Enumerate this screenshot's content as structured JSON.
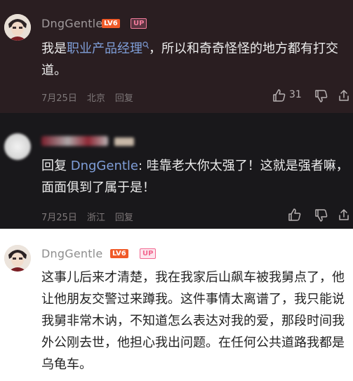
{
  "comments": [
    {
      "username": "DngGentle",
      "level_badge": "LV6",
      "up_badge": "UP",
      "text_prefix": "我是",
      "text_link": "职业产品经理",
      "text_suffix": "，所以和奇奇怪怪的地方都有打交道。",
      "date": "7月25日",
      "location": "北京",
      "reply_label": "回复",
      "like_count": "31"
    },
    {
      "username": "",
      "text_reply_word": "回复",
      "text_mention": "DngGentle",
      "text_body": ": 哇靠老大你太强了！这就是强者嘛，面面俱到了属于是！",
      "date": "7月25日",
      "location": "浙江",
      "reply_label": "回复"
    },
    {
      "username": "DngGentle",
      "level_badge": "LV6",
      "up_badge": "UP",
      "text": "这事儿后来才清楚，我在我家后山飙车被我舅点了，他让他朋友交警过来蹲我。这件事情太离谱了，我只能说我舅非常木讷，不知道怎么表达对我的爱，那段时间我外公刚去世，他担心我出问题。在任何公共道路我都是乌龟车。"
    }
  ],
  "icons": {
    "like": "thumbs-up-icon",
    "dislike": "thumbs-down-icon",
    "share": "share-icon",
    "search_hint": "search-icon"
  }
}
